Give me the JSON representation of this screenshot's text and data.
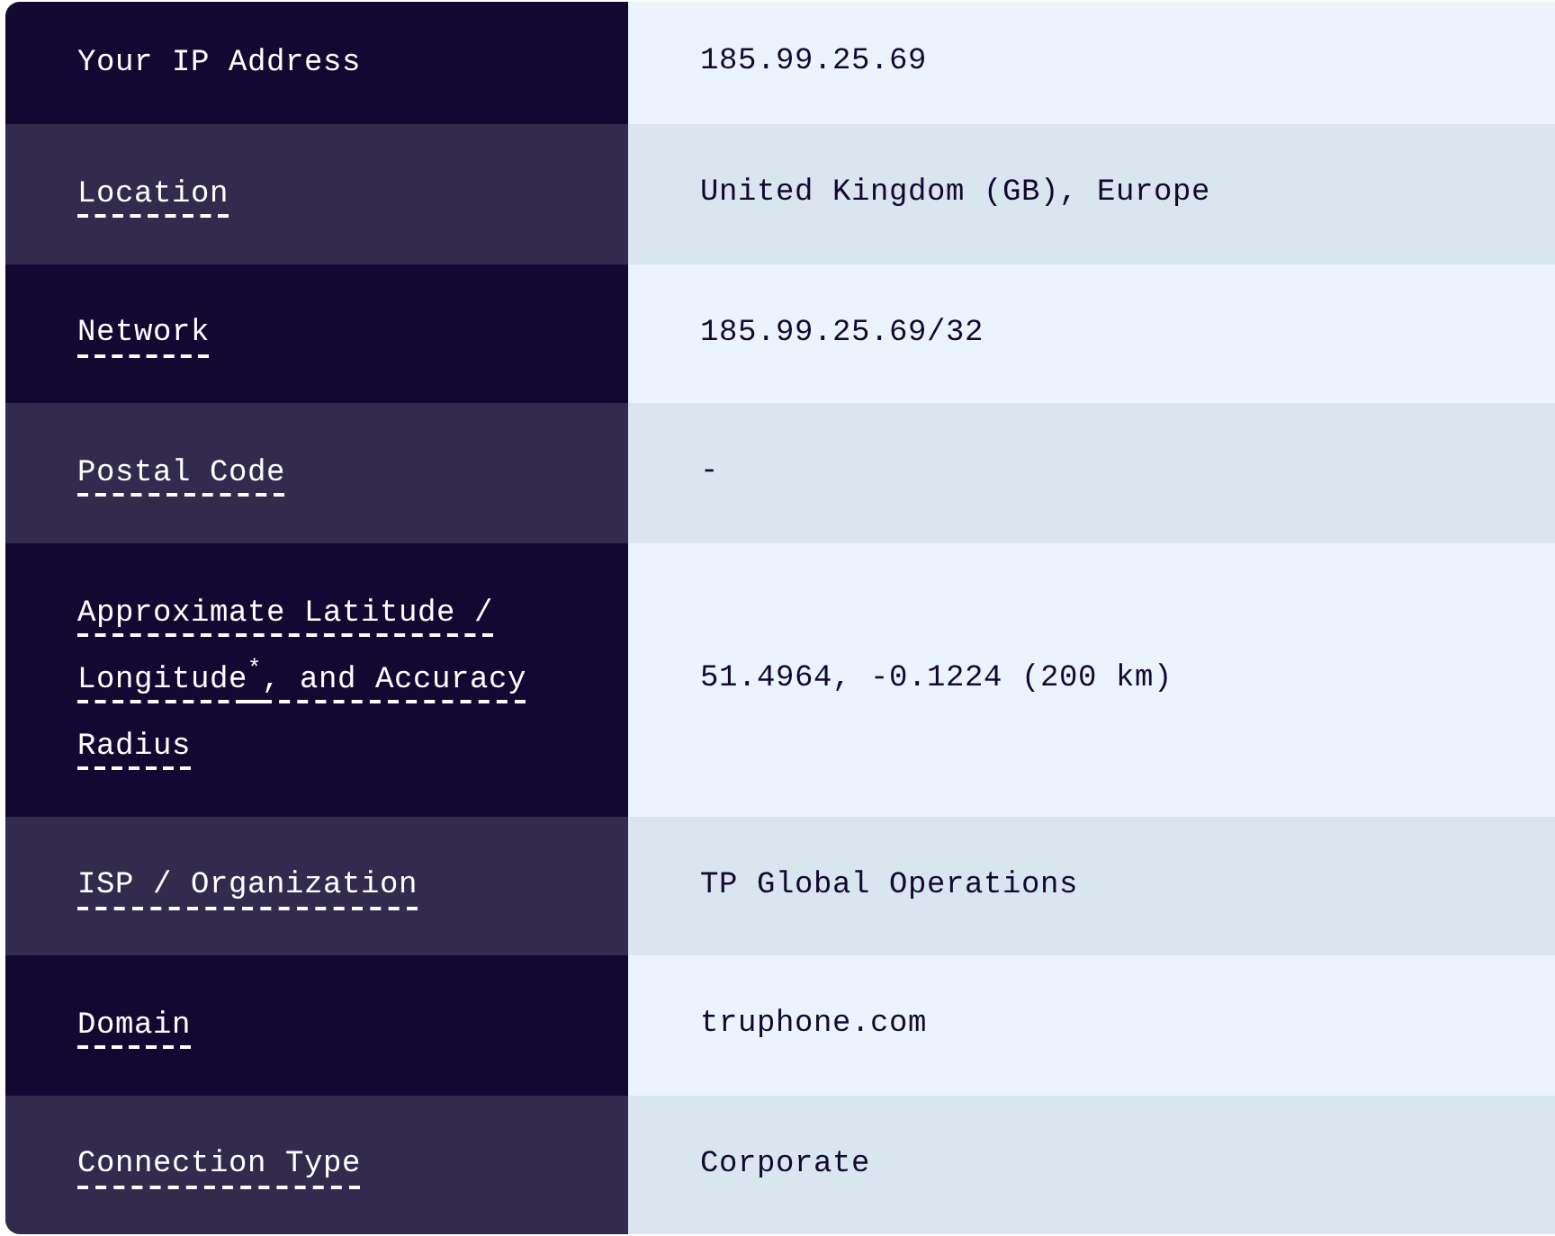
{
  "rows": [
    {
      "label": "Your IP Address",
      "underlined": false,
      "value": "185.99.25.69"
    },
    {
      "label": "Location",
      "underlined": true,
      "value": "United Kingdom (GB), Europe"
    },
    {
      "label": "Network",
      "underlined": true,
      "value": "185.99.25.69/32"
    },
    {
      "label": "Postal Code",
      "underlined": true,
      "value": "-"
    },
    {
      "label": "Approximate Latitude / Longitude$^{*}$, and Accuracy Radius",
      "underlined": true,
      "value": "51.4964, -0.1224 (200 km)"
    },
    {
      "label": "ISP / Organization",
      "underlined": true,
      "value": "TP Global Operations"
    },
    {
      "label": "Domain",
      "underlined": true,
      "value": "truphone.com"
    },
    {
      "label": "Connection Type",
      "underlined": true,
      "value": "Corporate"
    }
  ]
}
